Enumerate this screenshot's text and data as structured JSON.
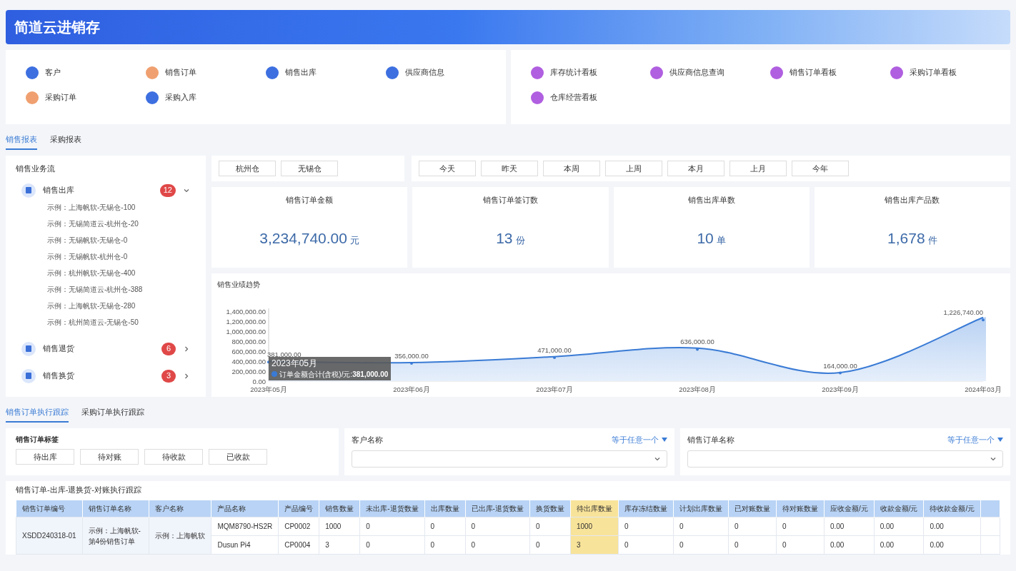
{
  "header": {
    "title": "简道云进销存"
  },
  "shortcuts_left": [
    {
      "label": "客户",
      "color": "#3d6fe0"
    },
    {
      "label": "销售订单",
      "color": "#f0a070"
    },
    {
      "label": "销售出库",
      "color": "#3d6fe0"
    },
    {
      "label": "供应商信息",
      "color": "#3d6fe0"
    },
    {
      "label": "采购订单",
      "color": "#f0a070"
    },
    {
      "label": "采购入库",
      "color": "#3d6fe0"
    }
  ],
  "shortcuts_right": [
    {
      "label": "库存统计看板",
      "color": "#b05fe0"
    },
    {
      "label": "供应商信息查询",
      "color": "#b05fe0"
    },
    {
      "label": "销售订单看板",
      "color": "#b05fe0"
    },
    {
      "label": "采购订单看板",
      "color": "#b05fe0"
    },
    {
      "label": "仓库经营看板",
      "color": "#b05fe0"
    }
  ],
  "report_tabs": [
    {
      "label": "销售报表",
      "selected": true
    },
    {
      "label": "采购报表",
      "selected": false
    }
  ],
  "flow": {
    "title": "销售业务流",
    "groups": [
      {
        "name": "销售出库",
        "count": "12",
        "expanded": true,
        "children": [
          "示例：上海帆软-无锡仓-100",
          "示例：无锡简道云-杭州仓-20",
          "示例：无锡帆软-无锡仓-0",
          "示例：无锡帆软-杭州仓-0",
          "示例：杭州帆软-无锡仓-400",
          "示例：无锡简道云-杭州仓-388",
          "示例：上海帆软-无锡仓-280",
          "示例：杭州简道云-无锡仓-50"
        ]
      },
      {
        "name": "销售退货",
        "count": "6",
        "expanded": false
      },
      {
        "name": "销售换货",
        "count": "3",
        "expanded": false
      }
    ]
  },
  "warehouses": [
    "杭州仓",
    "无锡仓"
  ],
  "periods": [
    "今天",
    "昨天",
    "本周",
    "上周",
    "本月",
    "上月",
    "今年"
  ],
  "stats": [
    {
      "title": "销售订单金额",
      "value": "3,234,740.00",
      "unit": "元"
    },
    {
      "title": "销售订单签订数",
      "value": "13",
      "unit": "份"
    },
    {
      "title": "销售出库单数",
      "value": "10",
      "unit": "单"
    },
    {
      "title": "销售出库产品数",
      "value": "1,678",
      "unit": "件"
    }
  ],
  "trend": {
    "title": "销售业绩趋势",
    "chart_data": {
      "type": "area",
      "categories": [
        "2023年05月",
        "2023年06月",
        "2023年07月",
        "2023年08月",
        "2023年09月",
        "2024年03月"
      ],
      "series": [
        {
          "color": "#3a7bd5",
          "values": [
            381000,
            356000,
            471000,
            636000,
            164000,
            1226740
          ]
        }
      ],
      "ylim": [
        0,
        1400000
      ],
      "yticks": [
        {
          "value": 0,
          "label": "0.00"
        },
        {
          "value": 200000,
          "label": "200,000.00"
        },
        {
          "value": 400000,
          "label": "400,000.00"
        },
        {
          "value": 600000,
          "label": "600,000.00"
        },
        {
          "value": 800000,
          "label": "800,000.00"
        },
        {
          "value": 1000000,
          "label": "1,000,000.00"
        },
        {
          "value": 1200000,
          "label": "1,200,000.00"
        },
        {
          "value": 1400000,
          "label": "1,400,000.00"
        }
      ],
      "value_labels": [
        "381,000.00",
        "356,000.00",
        "471,000.00",
        "636,000.00",
        "164,000.00",
        "1,226,740.00"
      ]
    },
    "tooltip": {
      "title": "2023年05月",
      "text": "订单金额合计(含税)/元:**381,000.00**"
    }
  },
  "track_tabs": [
    {
      "label": "销售订单执行跟踪",
      "selected": true
    },
    {
      "label": "采购订单执行跟踪",
      "selected": false
    }
  ],
  "tags": {
    "title": "销售订单标签",
    "items": [
      "待出库",
      "待对账",
      "待收款",
      "已收款"
    ]
  },
  "filters": [
    {
      "label": "客户名称",
      "operator": "等于任意一个"
    },
    {
      "label": "销售订单名称",
      "operator": "等于任意一个"
    }
  ],
  "table": {
    "title": "销售订单-出库-退换货-对账执行跟踪",
    "columns": [
      {
        "label": "销售订单编号",
        "highlight": false
      },
      {
        "label": "销售订单名称",
        "highlight": false
      },
      {
        "label": "客户名称",
        "highlight": false
      },
      {
        "label": "产品名称",
        "highlight": false
      },
      {
        "label": "产品编号",
        "highlight": false
      },
      {
        "label": "销售数量",
        "highlight": false
      },
      {
        "label": "未出库-退货数量",
        "highlight": false
      },
      {
        "label": "出库数量",
        "highlight": false
      },
      {
        "label": "已出库-退货数量",
        "highlight": false
      },
      {
        "label": "换货数量",
        "highlight": false
      },
      {
        "label": "待出库数量",
        "highlight": true
      },
      {
        "label": "库存冻结数量",
        "highlight": false
      },
      {
        "label": "计划出库数量",
        "highlight": false
      },
      {
        "label": "已对账数量",
        "highlight": false
      },
      {
        "label": "待对账数量",
        "highlight": false
      },
      {
        "label": "应收金额/元",
        "highlight": false
      },
      {
        "label": "收款金额/元",
        "highlight": false
      },
      {
        "label": "待收款金额/元",
        "highlight": false
      }
    ],
    "orders": [
      {
        "order_no": "XSDD240318-01",
        "order_name": "示例：上海帆软-第4份销售订单",
        "customer": "示例：上海帆软",
        "items": [
          [
            "MQM8790-HS2R",
            "CP0002",
            "1000",
            "0",
            "0",
            "0",
            "0",
            "1000",
            "0",
            "0",
            "0",
            "0",
            "0.00",
            "0.00",
            "0.00"
          ],
          [
            "Dusun Pi4",
            "CP0004",
            "3",
            "0",
            "0",
            "0",
            "0",
            "3",
            "0",
            "0",
            "0",
            "0",
            "0.00",
            "0.00",
            "0.00"
          ]
        ]
      }
    ]
  }
}
